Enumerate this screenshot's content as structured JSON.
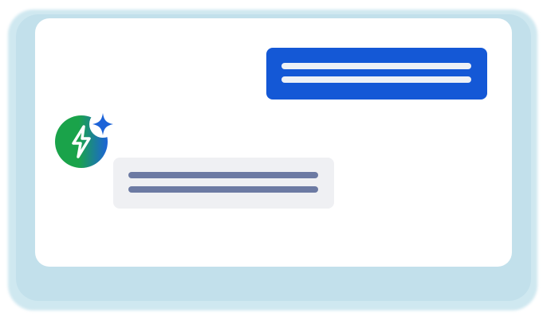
{
  "colors": {
    "glow": "#c2e0eb",
    "card": "#ffffff",
    "user_bubble": "#1458d6",
    "user_lines": "#eef1f6",
    "bot_bubble": "#eff0f3",
    "bot_lines": "#6c7aa3",
    "avatar_green": "#1aa34a",
    "avatar_blue": "#1c63d8",
    "sparkle": "#1c63d8"
  },
  "icons": {
    "assistant_avatar": "lightning-bolt-icon",
    "sparkle": "sparkle-icon"
  }
}
